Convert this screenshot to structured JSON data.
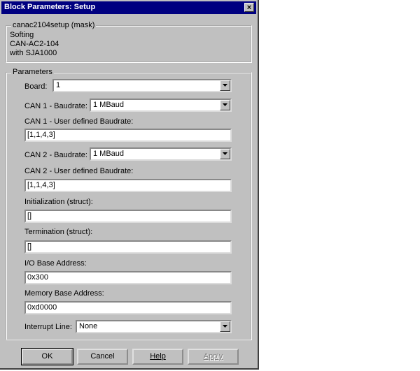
{
  "window": {
    "title": "Block Parameters: Setup",
    "close_glyph": "×"
  },
  "mask": {
    "group_label": "canac2104setup (mask)",
    "description_lines": [
      "Softing",
      "CAN-AC2-104",
      "with SJA1000"
    ]
  },
  "parameters": {
    "group_label": "Parameters",
    "board": {
      "label": "Board:",
      "value": "1"
    },
    "can1_baudrate": {
      "label": "CAN 1 - Baudrate:",
      "value": "1 MBaud"
    },
    "can1_user_baud": {
      "label": "CAN 1 - User defined Baudrate:",
      "value": "[1,1,4,3]"
    },
    "can2_baudrate": {
      "label": "CAN 2 - Baudrate:",
      "value": "1 MBaud"
    },
    "can2_user_baud": {
      "label": "CAN 2 - User defined Baudrate:",
      "value": "[1,1,4,3]"
    },
    "initialization": {
      "label": "Initialization (struct):",
      "value": "[]"
    },
    "termination": {
      "label": "Termination (struct):",
      "value": "[]"
    },
    "io_base": {
      "label": "I/O Base Address:",
      "value": "0x300"
    },
    "mem_base": {
      "label": "Memory Base Address:",
      "value": "0xd0000"
    },
    "interrupt": {
      "label": "Interrupt Line:",
      "value": "None"
    }
  },
  "buttons": {
    "ok": "OK",
    "cancel": "Cancel",
    "help": "Help",
    "apply": "Apply"
  },
  "colors": {
    "dialog_bg": "#c0c0c0",
    "titlebar": "#000080"
  }
}
